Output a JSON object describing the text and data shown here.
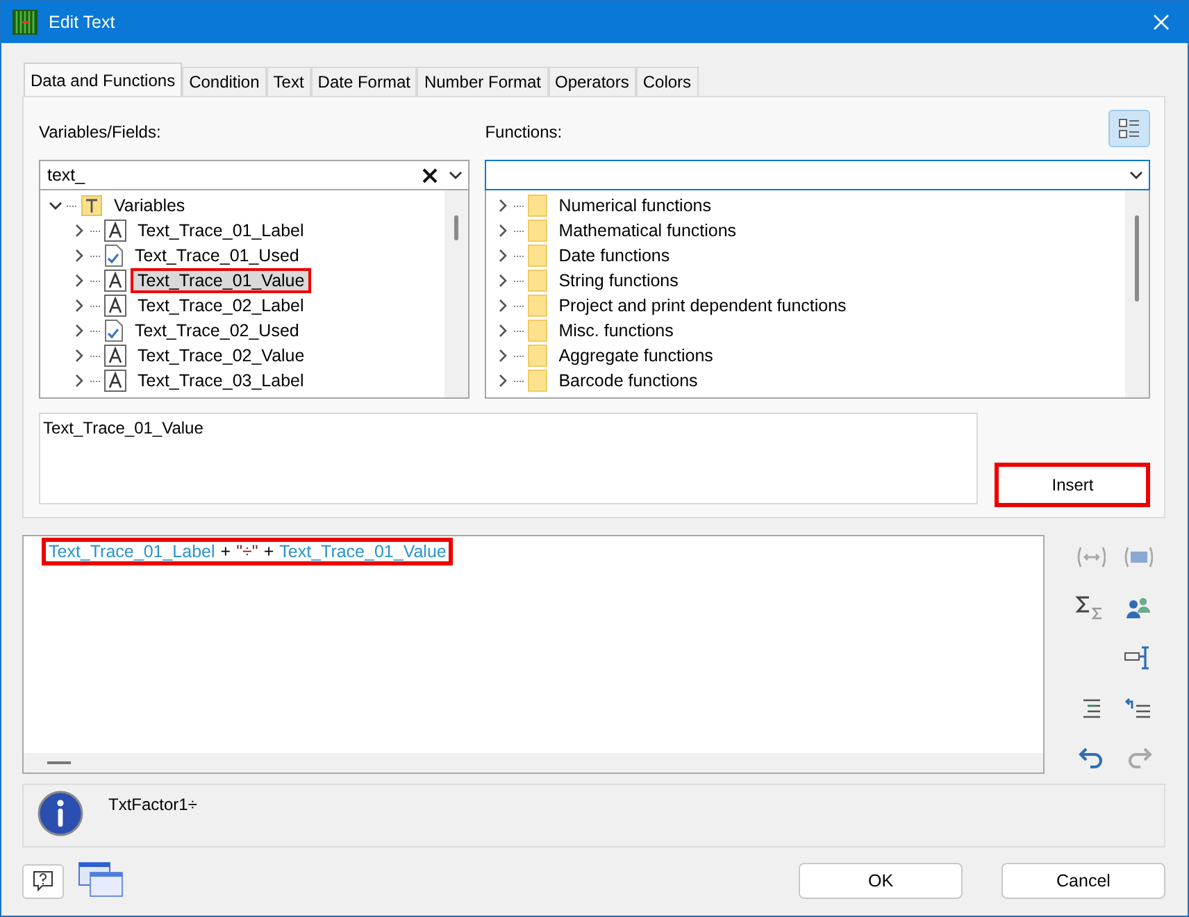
{
  "window": {
    "title": "Edit Text"
  },
  "tabs": [
    {
      "label": "Data and Functions",
      "selected": true
    },
    {
      "label": "Condition",
      "selected": false
    },
    {
      "label": "Text",
      "selected": false
    },
    {
      "label": "Date Format",
      "selected": false
    },
    {
      "label": "Number Format",
      "selected": false
    },
    {
      "label": "Operators",
      "selected": false
    },
    {
      "label": "Colors",
      "selected": false
    }
  ],
  "variables": {
    "label": "Variables/Fields:",
    "filter": {
      "value": "text_"
    },
    "tree": [
      {
        "label": "Variables",
        "kind": "group",
        "expanded": true,
        "children": [
          {
            "label": "Text_Trace_01_Label",
            "kind": "text",
            "selected": false,
            "highlighted": false
          },
          {
            "label": "Text_Trace_01_Used",
            "kind": "bool",
            "selected": false,
            "highlighted": false
          },
          {
            "label": "Text_Trace_01_Value",
            "kind": "text",
            "selected": true,
            "highlighted": true
          },
          {
            "label": "Text_Trace_02_Label",
            "kind": "text",
            "selected": false,
            "highlighted": false
          },
          {
            "label": "Text_Trace_02_Used",
            "kind": "bool",
            "selected": false,
            "highlighted": false
          },
          {
            "label": "Text_Trace_02_Value",
            "kind": "text",
            "selected": false,
            "highlighted": false
          },
          {
            "label": "Text_Trace_03_Label",
            "kind": "text",
            "selected": false,
            "highlighted": false
          }
        ]
      }
    ]
  },
  "functions": {
    "label": "Functions:",
    "view_toggle": {
      "pressed": true
    },
    "items": [
      {
        "label": "Numerical functions",
        "expanded": false
      },
      {
        "label": "Mathematical functions",
        "expanded": false
      },
      {
        "label": "Date functions",
        "expanded": false
      },
      {
        "label": "String functions",
        "expanded": false
      },
      {
        "label": "Project and print dependent functions",
        "expanded": false
      },
      {
        "label": "Misc. functions",
        "expanded": false
      },
      {
        "label": "Aggregate functions",
        "expanded": false
      },
      {
        "label": "Barcode functions",
        "expanded": false
      }
    ]
  },
  "preview": {
    "text": "Text_Trace_01_Value"
  },
  "insert_button": {
    "label": "Insert",
    "highlighted": true
  },
  "expression": {
    "highlighted": true,
    "tokens": [
      {
        "text": "Text_Trace_01_Label",
        "kind": "field"
      },
      {
        "text": "+",
        "kind": "operator"
      },
      {
        "text": "\"÷\"",
        "kind": "string"
      },
      {
        "text": "+",
        "kind": "operator"
      },
      {
        "text": "Text_Trace_01_Value",
        "kind": "field"
      }
    ]
  },
  "toolbar": [
    [
      {
        "kind": "brace",
        "disabled": true
      },
      {
        "kind": "field",
        "disabled": true
      }
    ],
    [
      {
        "kind": "sum",
        "disabled": false
      },
      {
        "kind": "users",
        "disabled": false
      }
    ],
    [
      {
        "kind": "insert",
        "disabled": false
      }
    ],
    [
      {
        "kind": "indent",
        "disabled": false
      },
      {
        "kind": "outdent",
        "disabled": false
      }
    ],
    [
      {
        "kind": "undo",
        "disabled": false
      },
      {
        "kind": "redo",
        "disabled": true
      }
    ]
  ],
  "info": {
    "text": "TxtFactor1÷"
  },
  "buttons": [
    {
      "label": "OK"
    },
    {
      "label": "Cancel"
    }
  ]
}
